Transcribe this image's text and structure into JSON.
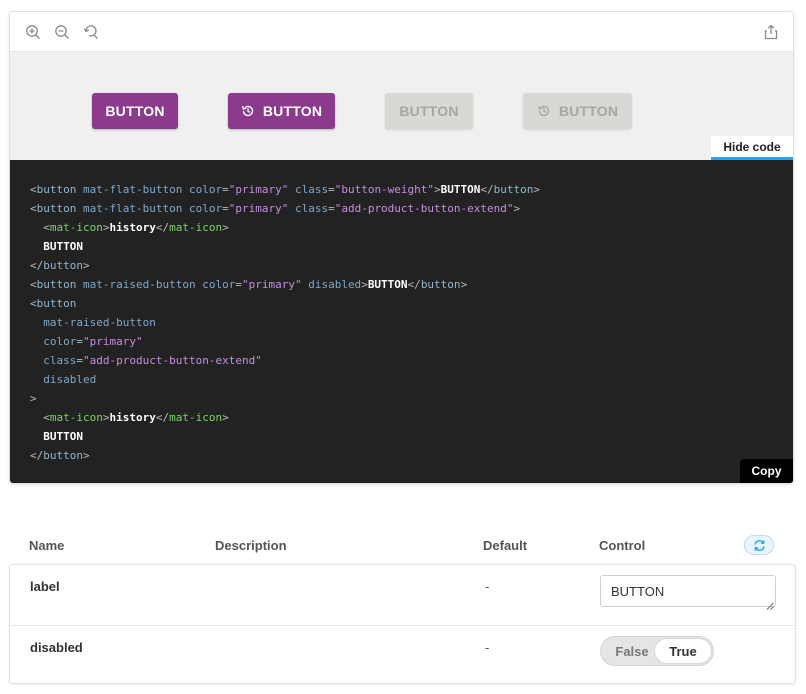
{
  "colors": {
    "primary": "#8b3a8e",
    "disabled_bg": "#d8d8d4",
    "code_bg": "#222222",
    "accent_blue": "#1ea7fd"
  },
  "toolbar": {
    "icons": [
      "zoom-in-icon",
      "zoom-out-icon",
      "reset-zoom-icon",
      "share-icon"
    ]
  },
  "preview": {
    "buttons": [
      {
        "label": "BUTTON",
        "icon": null,
        "state": "enabled"
      },
      {
        "label": "BUTTON",
        "icon": "history-icon",
        "state": "enabled"
      },
      {
        "label": "BUTTON",
        "icon": null,
        "state": "disabled"
      },
      {
        "label": "BUTTON",
        "icon": "history-icon",
        "state": "disabled"
      }
    ],
    "hide_code_label": "Hide code"
  },
  "code": {
    "lines": [
      "<button mat-flat-button color=\"primary\" class=\"button-weight\">BUTTON</button>",
      "<button mat-flat-button color=\"primary\" class=\"add-product-button-extend\">",
      "  <mat-icon>history</mat-icon>",
      "  BUTTON",
      "</button>",
      "<button mat-raised-button color=\"primary\" disabled>BUTTON</button>",
      "<button",
      "  mat-raised-button",
      "  color=\"primary\"",
      "  class=\"add-product-button-extend\"",
      "  disabled",
      ">",
      "  <mat-icon>history</mat-icon>",
      "  BUTTON",
      "</button>"
    ],
    "copy_label": "Copy"
  },
  "args_table": {
    "headers": {
      "name": "Name",
      "description": "Description",
      "default": "Default",
      "control": "Control"
    },
    "rows": [
      {
        "name": "label",
        "description": "",
        "default": "-",
        "control_value": "BUTTON"
      },
      {
        "name": "disabled",
        "description": "",
        "default": "-",
        "toggle_false": "False",
        "toggle_true": "True",
        "selected": "True"
      }
    ]
  }
}
